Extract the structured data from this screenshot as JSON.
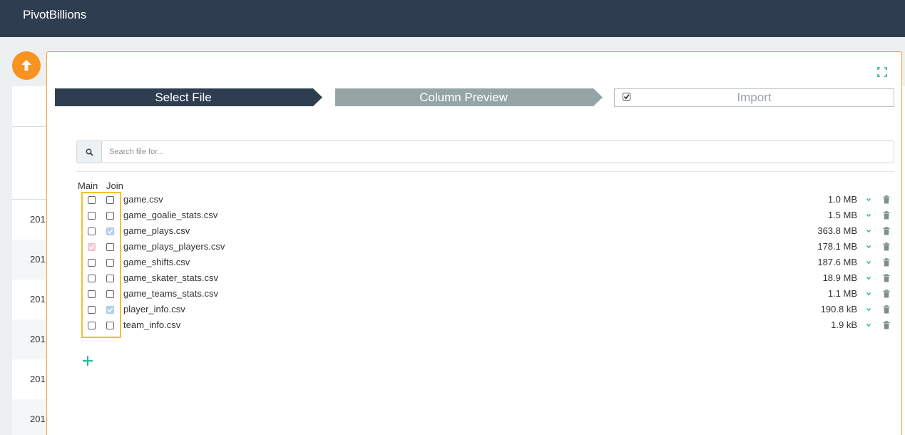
{
  "app": {
    "title": "PivotBillions"
  },
  "background": {
    "years": [
      "201",
      "201",
      "201",
      "201",
      "201",
      "201"
    ]
  },
  "wizard": {
    "steps": [
      {
        "label": "Select File",
        "state": "active"
      },
      {
        "label": "Column Preview",
        "state": "inactive"
      },
      {
        "label": "Import",
        "state": "pending"
      }
    ]
  },
  "search": {
    "placeholder": "Search file for...",
    "value": ""
  },
  "columns": {
    "main": "Main",
    "join": "Join"
  },
  "files": [
    {
      "name": "game.csv",
      "size": "1.0 MB",
      "main": false,
      "join": false
    },
    {
      "name": "game_goalie_stats.csv",
      "size": "1.5 MB",
      "main": false,
      "join": false
    },
    {
      "name": "game_plays.csv",
      "size": "363.8 MB",
      "main": false,
      "join": true
    },
    {
      "name": "game_plays_players.csv",
      "size": "178.1 MB",
      "main": true,
      "join": false
    },
    {
      "name": "game_shifts.csv",
      "size": "187.6 MB",
      "main": false,
      "join": false
    },
    {
      "name": "game_skater_stats.csv",
      "size": "18.9 MB",
      "main": false,
      "join": false
    },
    {
      "name": "game_teams_stats.csv",
      "size": "1.1 MB",
      "main": false,
      "join": false
    },
    {
      "name": "player_info.csv",
      "size": "190.8 kB",
      "main": false,
      "join": true
    },
    {
      "name": "team_info.csv",
      "size": "1.9 kB",
      "main": false,
      "join": false
    }
  ],
  "icons": {
    "upload": "arrow-up-icon",
    "expand": "fullscreen-icon",
    "search": "search-icon",
    "row_expand": "chevron-down-icon",
    "row_delete": "trash-icon",
    "add": "plus-icon"
  },
  "colors": {
    "topbar": "#2e3e50",
    "step_active": "#2e3e50",
    "step_inactive": "#95a5a6",
    "accent_orange": "#f7931e",
    "highlight": "#f2c12e",
    "add_green": "#1abc9c"
  }
}
